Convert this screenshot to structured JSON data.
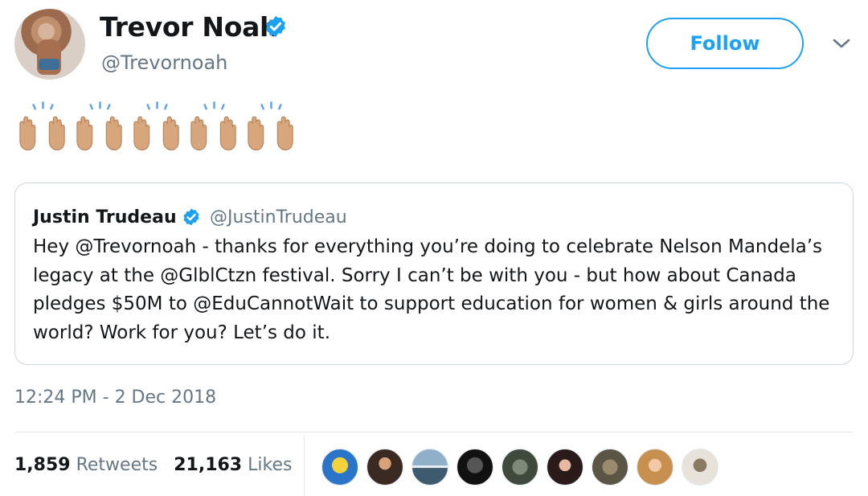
{
  "author": {
    "name": "Trevor Noah",
    "handle": "@Trevornoah"
  },
  "follow_label": "Follow",
  "emoji_count": 5,
  "quoted": {
    "name": "Justin Trudeau",
    "handle": "@JustinTrudeau",
    "text": "Hey @Trevornoah - thanks for everything you’re doing to celebrate Nelson Mandela’s legacy at the @GlblCtzn festival. Sorry I can’t be with you - but how about Canada pledges $50M to @EduCannotWait to support education for women & girls around the world? Work for you? Let’s do it."
  },
  "timestamp": "12:24 PM - 2 Dec 2018",
  "stats": {
    "retweets_count": "1,859",
    "retweets_label": "Retweets",
    "likes_count": "21,163",
    "likes_label": "Likes"
  },
  "colors": {
    "accent": "#1da1f2",
    "muted": "#657786",
    "border": "#e1e8ed"
  }
}
